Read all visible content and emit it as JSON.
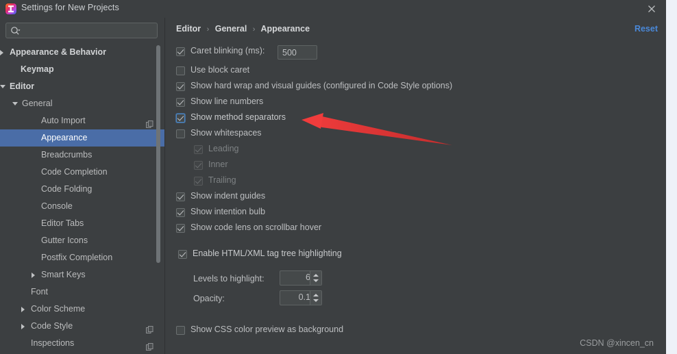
{
  "window": {
    "title": "Settings for New Projects",
    "logo_icon": "intellij-idea-logo",
    "close_icon": "close-icon"
  },
  "sidebar": {
    "search": {
      "icon": "search-icon",
      "value": "",
      "placeholder": ""
    },
    "items": [
      {
        "label": "Appearance & Behavior",
        "indent": 14,
        "twisty": "collapsed",
        "bold": true,
        "selected": false,
        "copy": false
      },
      {
        "label": "Keymap",
        "indent": 30,
        "twisty": "none",
        "bold": true,
        "selected": false,
        "copy": false
      },
      {
        "label": "Editor",
        "indent": 14,
        "twisty": "expanded",
        "bold": true,
        "selected": false,
        "copy": false
      },
      {
        "label": "General",
        "indent": 32,
        "twisty": "expanded",
        "bold": false,
        "selected": false,
        "copy": false
      },
      {
        "label": "Auto Import",
        "indent": 60,
        "twisty": "none",
        "bold": false,
        "selected": false,
        "copy": true
      },
      {
        "label": "Appearance",
        "indent": 60,
        "twisty": "none",
        "bold": false,
        "selected": true,
        "copy": false
      },
      {
        "label": "Breadcrumbs",
        "indent": 60,
        "twisty": "none",
        "bold": false,
        "selected": false,
        "copy": false
      },
      {
        "label": "Code Completion",
        "indent": 60,
        "twisty": "none",
        "bold": false,
        "selected": false,
        "copy": false
      },
      {
        "label": "Code Folding",
        "indent": 60,
        "twisty": "none",
        "bold": false,
        "selected": false,
        "copy": false
      },
      {
        "label": "Console",
        "indent": 60,
        "twisty": "none",
        "bold": false,
        "selected": false,
        "copy": false
      },
      {
        "label": "Editor Tabs",
        "indent": 60,
        "twisty": "none",
        "bold": false,
        "selected": false,
        "copy": false
      },
      {
        "label": "Gutter Icons",
        "indent": 60,
        "twisty": "none",
        "bold": false,
        "selected": false,
        "copy": false
      },
      {
        "label": "Postfix Completion",
        "indent": 60,
        "twisty": "none",
        "bold": false,
        "selected": false,
        "copy": false
      },
      {
        "label": "Smart Keys",
        "indent": 60,
        "twisty": "collapsed",
        "bold": false,
        "selected": false,
        "copy": false
      },
      {
        "label": "Font",
        "indent": 45,
        "twisty": "none",
        "bold": false,
        "selected": false,
        "copy": false
      },
      {
        "label": "Color Scheme",
        "indent": 45,
        "twisty": "collapsed",
        "bold": false,
        "selected": false,
        "copy": false
      },
      {
        "label": "Code Style",
        "indent": 45,
        "twisty": "collapsed",
        "bold": false,
        "selected": false,
        "copy": true
      },
      {
        "label": "Inspections",
        "indent": 45,
        "twisty": "none",
        "bold": false,
        "selected": false,
        "copy": true
      }
    ]
  },
  "main": {
    "breadcrumb": {
      "c0": "Editor",
      "c1": "General",
      "c2": "Appearance",
      "separator": "›"
    },
    "reset_label": "Reset",
    "options": {
      "caret_blinking": {
        "label": "Caret blinking (ms):",
        "checked": true,
        "value": "500"
      },
      "use_block_caret": {
        "label": "Use block caret",
        "checked": false
      },
      "show_hard_wrap": {
        "label": "Show hard wrap and visual guides (configured in Code Style options)",
        "checked": true
      },
      "show_line_numbers": {
        "label": "Show line numbers",
        "checked": true
      },
      "show_method_sep": {
        "label": "Show method separators",
        "checked": true,
        "focused": true
      },
      "show_whitespaces": {
        "label": "Show whitespaces",
        "checked": false
      },
      "ws_leading": {
        "label": "Leading",
        "checked": true,
        "disabled": true
      },
      "ws_inner": {
        "label": "Inner",
        "checked": true,
        "disabled": true
      },
      "ws_trailing": {
        "label": "Trailing",
        "checked": true,
        "disabled": true
      },
      "show_indent_guides": {
        "label": "Show indent guides",
        "checked": true
      },
      "show_intention_bulb": {
        "label": "Show intention bulb",
        "checked": true
      },
      "show_code_lens": {
        "label": "Show code lens on scrollbar hover",
        "checked": true
      },
      "enable_tag_tree": {
        "label": "Enable HTML/XML tag tree highlighting",
        "checked": true
      },
      "levels_to_highlight": {
        "label": "Levels to highlight:",
        "value": "6"
      },
      "opacity": {
        "label": "Opacity:",
        "value": "0.1"
      },
      "show_css_preview": {
        "label": "Show CSS color preview as background",
        "checked": false
      }
    }
  },
  "annotation": {
    "arrow_color": "#ef3b3b",
    "arrow_icon": "red-arrow-annotation"
  },
  "watermark": {
    "text": "CSDN @xincen_cn"
  },
  "colors": {
    "window_bg": "#3c3f41",
    "selection": "#4a6da7",
    "link": "#4a88d8",
    "text": "#bdbfc1",
    "desktop": "#eef1f8"
  }
}
